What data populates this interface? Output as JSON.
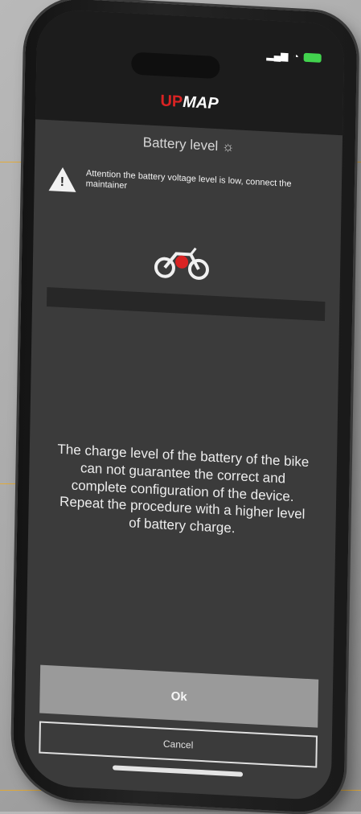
{
  "app": {
    "logo_part1": "UP",
    "logo_part2": "MAP"
  },
  "screen": {
    "title": "Battery level"
  },
  "warning": {
    "text": "Attention the battery voltage level is low, connect the maintainer"
  },
  "battery": {
    "value": ""
  },
  "message": {
    "line1": "The charge level of the battery of the bike",
    "line2": "can not guarantee the correct and",
    "line3": "complete configuration of the device.",
    "line4": "Repeat the procedure with a higher level",
    "line5": "of battery charge."
  },
  "actions": {
    "ok_label": "Ok",
    "cancel_label": "Cancel"
  },
  "colors": {
    "accent": "#d92323",
    "highlight": "#f2b321"
  }
}
